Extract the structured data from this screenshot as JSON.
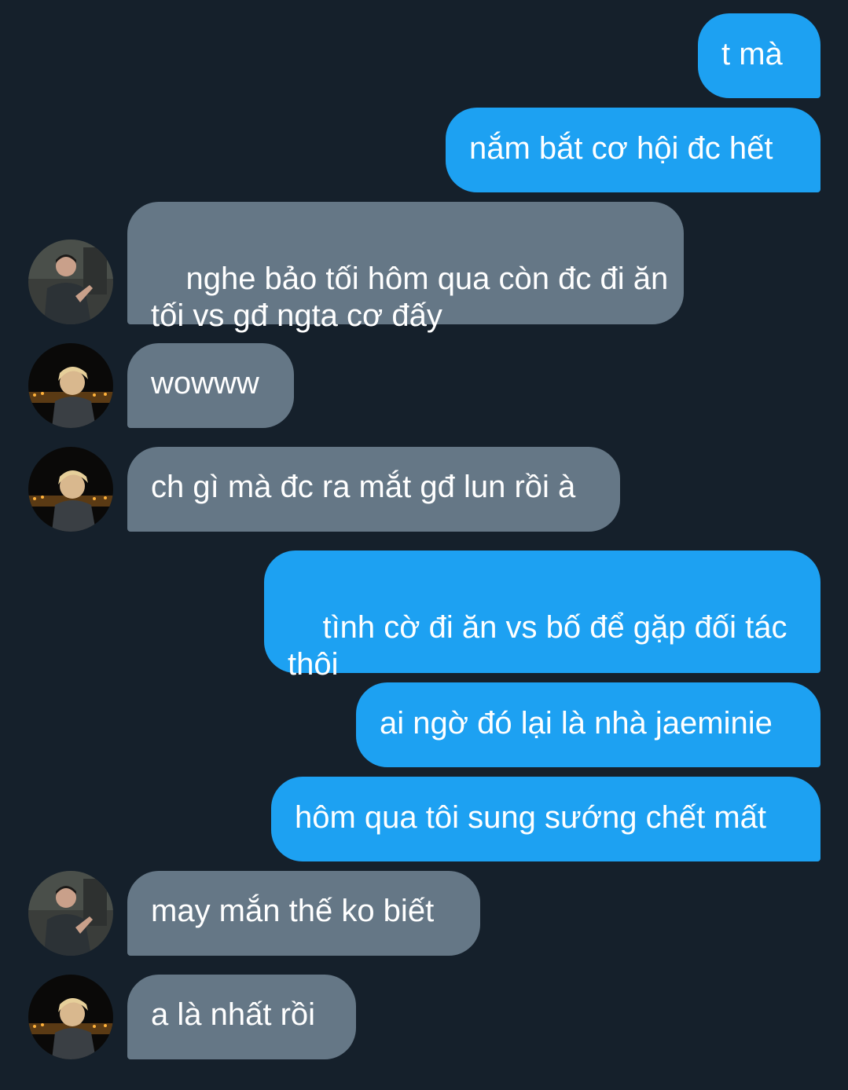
{
  "conversation": {
    "messages": [
      {
        "direction": "outgoing",
        "text": "t mà"
      },
      {
        "direction": "outgoing",
        "text": "nắm bắt cơ hội đc hết"
      },
      {
        "direction": "incoming",
        "sender_avatar": "avatar-dark-room",
        "text": "nghe bảo tối hôm qua còn đc đi ăn\ntối vs gđ ngta cơ đấy"
      },
      {
        "direction": "incoming",
        "sender_avatar": "avatar-blonde-night",
        "text": "wowww"
      },
      {
        "direction": "incoming",
        "sender_avatar": "avatar-blonde-night",
        "text": "ch gì mà đc ra mắt gđ lun rồi à"
      },
      {
        "direction": "outgoing",
        "text": "tình cờ đi ăn vs bố để gặp đối tác\nthôi"
      },
      {
        "direction": "outgoing",
        "text": "ai ngờ đó lại là nhà jaeminie"
      },
      {
        "direction": "outgoing",
        "text": "hôm qua tôi sung sướng chết mất"
      },
      {
        "direction": "incoming",
        "sender_avatar": "avatar-dark-room",
        "text": "may mắn thế ko biết"
      },
      {
        "direction": "incoming",
        "sender_avatar": "avatar-blonde-night",
        "text": "a là nhất rồi"
      }
    ]
  },
  "colors": {
    "background": "#15202b",
    "outgoing_bubble": "#1da1f2",
    "incoming_bubble": "#657786",
    "text": "#ffffff"
  }
}
